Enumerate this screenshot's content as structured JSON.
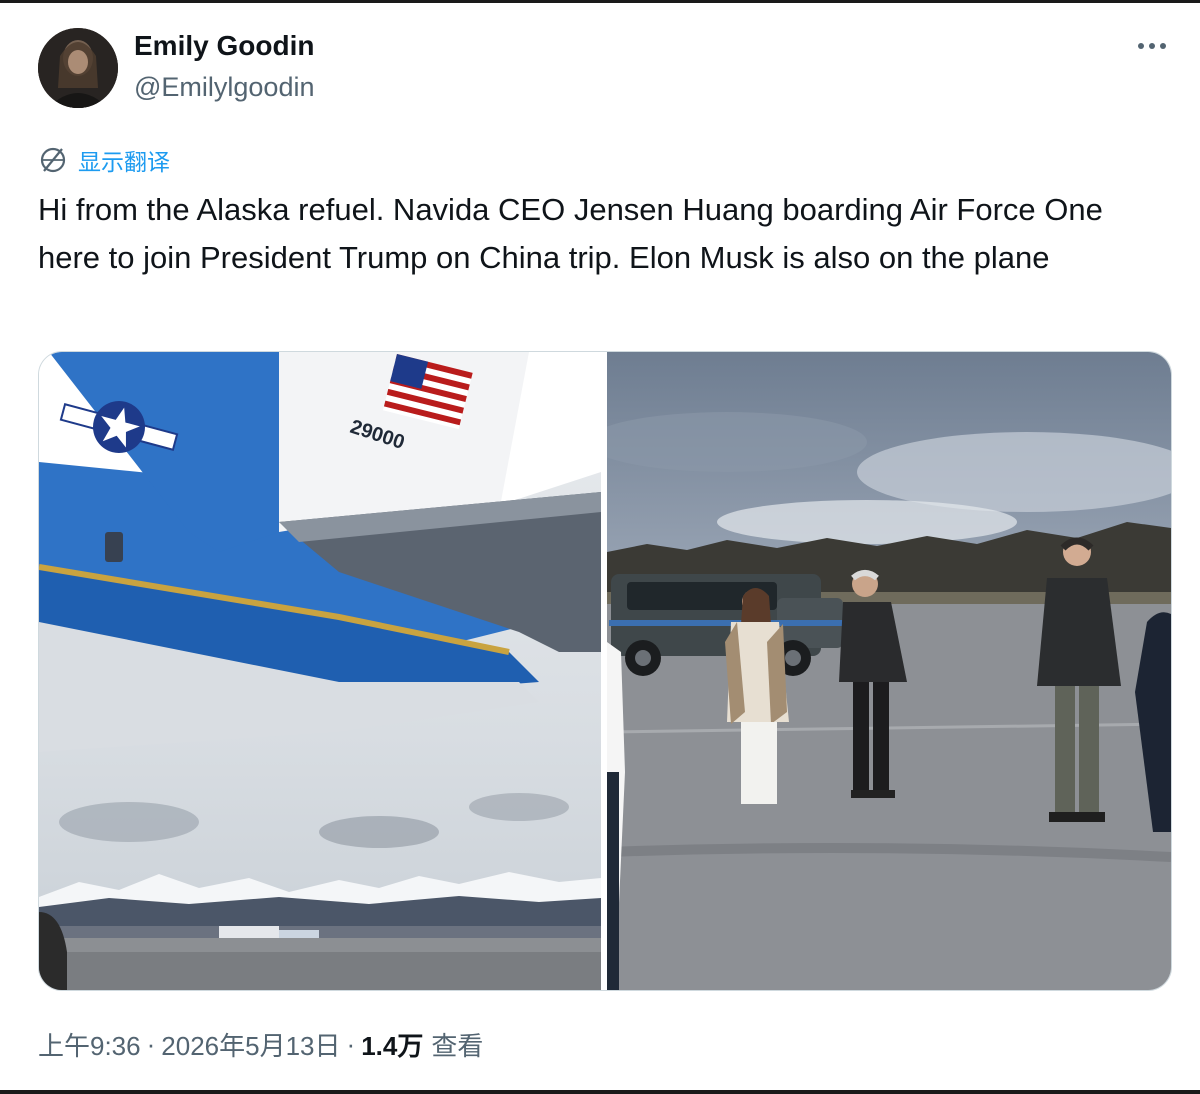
{
  "author": {
    "display_name": "Emily Goodin",
    "handle": "@Emilylgoodin"
  },
  "header": {
    "more_icon": "more-horizontal-icon"
  },
  "translate": {
    "icon": "translate-globe-icon",
    "label": "显示翻译"
  },
  "tweet": {
    "text": "Hi from the Alaska refuel. Navida CEO Jensen Huang boarding Air Force One here to join President Trump on China trip. Elon Musk is also on the plane"
  },
  "media": {
    "tail_number": "29000"
  },
  "meta": {
    "time": "上午9:36",
    "separator": "·",
    "date": "2026年5月13日",
    "views_count": "1.4万",
    "views_label": "查看"
  },
  "colors": {
    "accent": "#1d9bf0",
    "secondary_text": "#536471",
    "primary_text": "#0f1419",
    "border": "#cfd9de"
  }
}
